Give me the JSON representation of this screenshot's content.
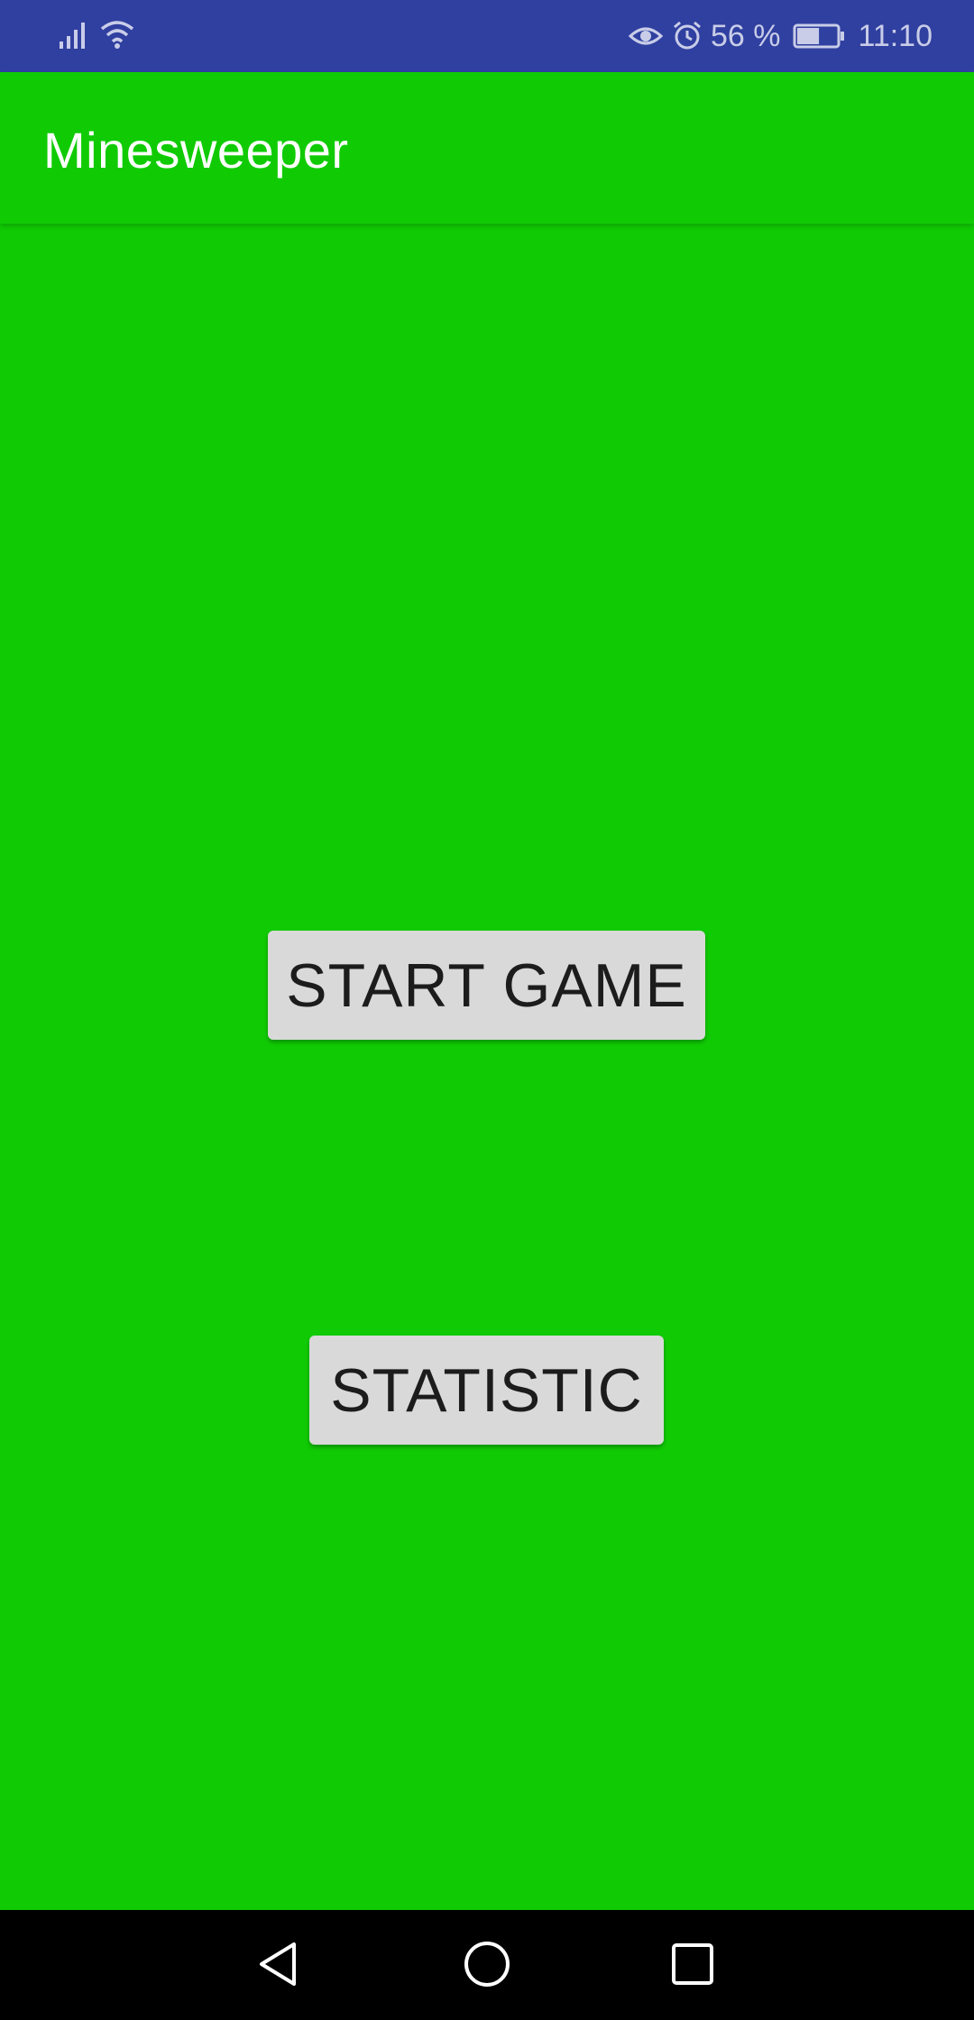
{
  "status_bar": {
    "battery_percent": "56 %",
    "battery_level": 0.56,
    "time": "11:10",
    "icons": [
      "signal-icon",
      "wifi-icon",
      "eye-icon",
      "alarm-icon",
      "battery-icon"
    ]
  },
  "app_bar": {
    "title": "Minesweeper"
  },
  "main": {
    "start_label": "START GAME",
    "statistic_label": "STATISTIC"
  },
  "nav_bar": {
    "icons": [
      "back-icon",
      "home-icon",
      "recents-icon"
    ]
  },
  "colors": {
    "background": "#10cb04",
    "status_bar": "#3040a0",
    "button": "#d9d9d9",
    "button_text": "#1c1c1c",
    "nav_bar": "#000000"
  }
}
